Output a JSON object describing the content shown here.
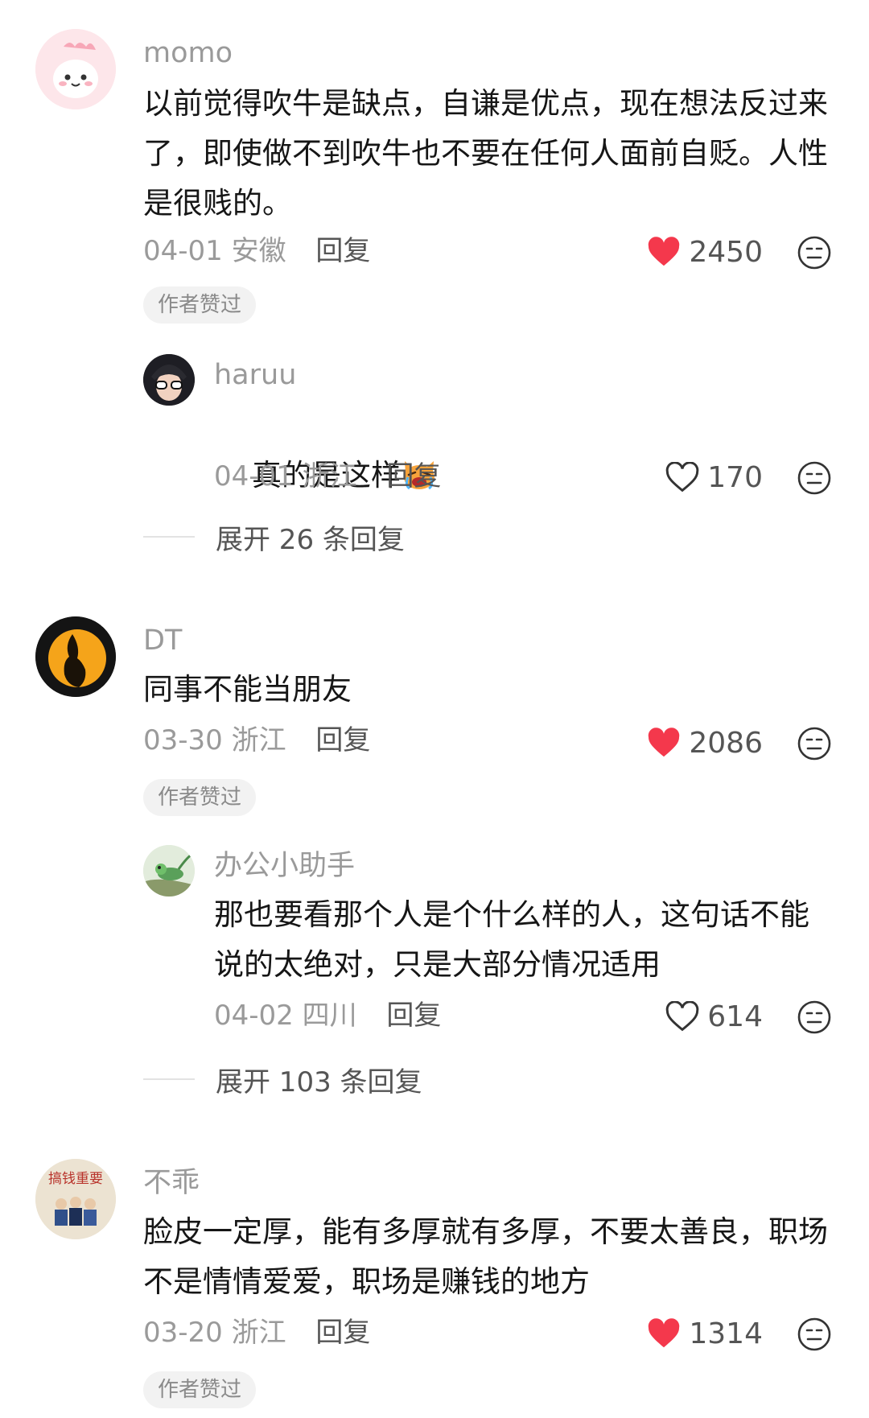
{
  "comments": [
    {
      "username": "momo",
      "text": "以前觉得吹牛是缺点，自谦是优点，现在想法反过来了，即使做不到吹牛也不要在任何人面前自贬。人性是很贱的。",
      "date": "04-01",
      "location": "安徽",
      "reply_label": "回复",
      "likes": "2450",
      "liked": true,
      "author_liked_badge": "作者赞过",
      "sub_reply": {
        "username": "haruu",
        "text": "真的是这样",
        "emoji": "crying-cat-emoji",
        "date": "04-01",
        "location": "浙江",
        "reply_label": "回复",
        "likes": "170",
        "liked": false
      },
      "expand_label": "展开 26 条回复"
    },
    {
      "username": "DT",
      "text": "同事不能当朋友",
      "date": "03-30",
      "location": "浙江",
      "reply_label": "回复",
      "likes": "2086",
      "liked": true,
      "author_liked_badge": "作者赞过",
      "sub_reply": {
        "username": "办公小助手",
        "text": "那也要看那个人是个什么样的人，这句话不能说的太绝对，只是大部分情况适用",
        "date": "04-02",
        "location": "四川",
        "reply_label": "回复",
        "likes": "614",
        "liked": false
      },
      "expand_label": "展开 103 条回复"
    },
    {
      "username": "不乖",
      "avatar_text": "搞钱重要",
      "text": "脸皮一定厚，能有多厚就有多厚，不要太善良，职场不是情情爱爱，职场是赚钱的地方",
      "date": "03-20",
      "location": "浙江",
      "reply_label": "回复",
      "likes": "1314",
      "liked": true,
      "author_liked_badge": "作者赞过"
    }
  ],
  "colors": {
    "liked_heart": "#f4384c",
    "meta_gray": "#9a9a9a",
    "badge_bg": "#f2f2f2"
  }
}
